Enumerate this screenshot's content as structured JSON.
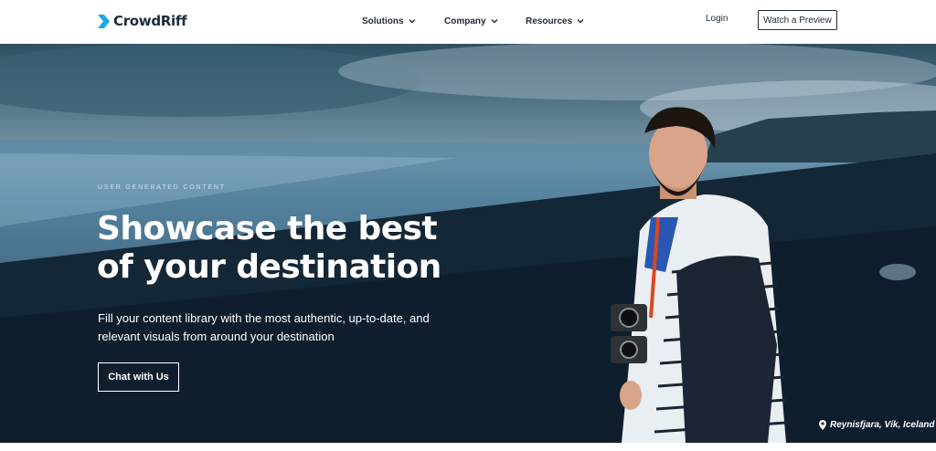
{
  "nav": {
    "logo_text": "CrowdRiff",
    "menu": [
      {
        "label": "Solutions"
      },
      {
        "label": "Company"
      },
      {
        "label": "Resources"
      }
    ],
    "login_label": "Login",
    "preview_label": "Watch a Preview"
  },
  "hero": {
    "eyebrow": "USER GENERATED CONTENT",
    "headline_line1": "Showcase the best",
    "headline_line2": "of your destination",
    "subtext_line1": "Fill your content library with the most authentic, up-to-date, and",
    "subtext_line2": "relevant visuals from around your destination",
    "cta_label": "Chat with Us",
    "location_label": "Reynisfjara, Vík, Iceland"
  },
  "colors": {
    "brand": "#1d2b3a",
    "logo_accent": "#1ea7e1"
  },
  "icons": [
    "crowdriff-logo-icon",
    "chevron-down-icon",
    "location-pin-icon"
  ]
}
